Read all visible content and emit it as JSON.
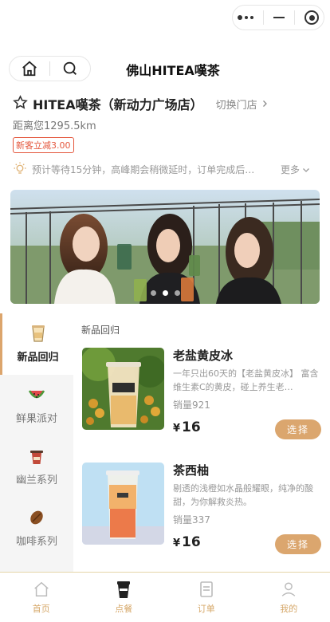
{
  "nav": {
    "title": "佛山HITEA嘆茶"
  },
  "store": {
    "name": "HITEA嘆茶（新动力广场店）",
    "switch_label": "切换门店",
    "distance": "距离您1295.5km",
    "coupon": "新客立减3.00",
    "notice": "预计等待15分钟，高峰期会稍微延时，订单完成后…",
    "more": "更多"
  },
  "banner": {
    "dot_count": 3,
    "active_dot": 1
  },
  "sidebar": {
    "items": [
      {
        "label": "新品回归",
        "icon": "iced-drink-icon",
        "active": true
      },
      {
        "label": "鲜果派对",
        "icon": "watermelon-icon",
        "active": false
      },
      {
        "label": "幽兰系列",
        "icon": "tea-cup-icon",
        "active": false
      },
      {
        "label": "咖啡系列",
        "icon": "coffee-bean-icon",
        "active": false
      }
    ]
  },
  "section": {
    "title": "新品回归"
  },
  "products": [
    {
      "name": "老盐黄皮冰",
      "desc": "一年只出60天的【老盐黄皮冰】 富含维生素C的黄皮，碰上养生老…",
      "sales": "销量921",
      "currency": "¥",
      "price": "16",
      "button": "选择"
    },
    {
      "name": "茶西柚",
      "desc": "剔透的浅橙如水晶般耀眼，纯净的酸甜，为你解救炎热。",
      "sales": "销量337",
      "currency": "¥",
      "price": "16",
      "button": "选择"
    }
  ],
  "tabbar": {
    "items": [
      {
        "label": "首页",
        "icon": "home-icon"
      },
      {
        "label": "点餐",
        "icon": "order-cup-icon"
      },
      {
        "label": "订单",
        "icon": "receipt-icon"
      },
      {
        "label": "我的",
        "icon": "user-icon"
      }
    ]
  },
  "colors": {
    "accent": "#dba66e",
    "coupon": "#e4573d",
    "sidebar_bg": "#f5f5f5"
  }
}
